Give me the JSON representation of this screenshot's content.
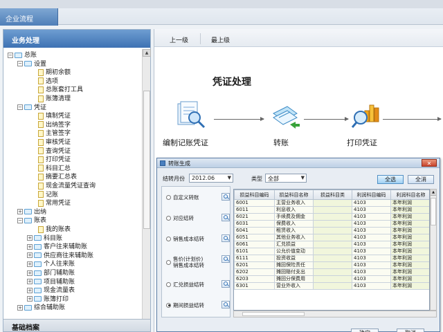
{
  "tabs": {
    "active": "企业流程"
  },
  "left_panel": {
    "header": "业务处理",
    "footer": "基础档案",
    "tree": [
      {
        "label": "总账",
        "type": "folder",
        "toggle": "−"
      },
      {
        "label": "设置",
        "type": "folder",
        "toggle": "−"
      },
      {
        "label": "期初余额",
        "type": "doc"
      },
      {
        "label": "选项",
        "type": "doc"
      },
      {
        "label": "总账套打工具",
        "type": "doc"
      },
      {
        "label": "账簿清理",
        "type": "doc"
      },
      {
        "label": "凭证",
        "type": "folder",
        "toggle": "−"
      },
      {
        "label": "填制凭证",
        "type": "doc"
      },
      {
        "label": "出纳签字",
        "type": "doc"
      },
      {
        "label": "主管签字",
        "type": "doc"
      },
      {
        "label": "审核凭证",
        "type": "doc"
      },
      {
        "label": "查询凭证",
        "type": "doc"
      },
      {
        "label": "打印凭证",
        "type": "doc"
      },
      {
        "label": "科目汇总",
        "type": "doc"
      },
      {
        "label": "摘要汇总表",
        "type": "doc"
      },
      {
        "label": "现金流量凭证查询",
        "type": "doc"
      },
      {
        "label": "记账",
        "type": "doc"
      },
      {
        "label": "常用凭证",
        "type": "doc"
      },
      {
        "label": "出纳",
        "type": "folder",
        "toggle": "+"
      },
      {
        "label": "账表",
        "type": "folder",
        "toggle": "−"
      },
      {
        "label": "我的账表",
        "type": "doc"
      },
      {
        "label": "科目账",
        "type": "folder",
        "toggle": "+"
      },
      {
        "label": "客户往来辅助账",
        "type": "folder",
        "toggle": "+"
      },
      {
        "label": "供应商往来辅助账",
        "type": "folder",
        "toggle": "+"
      },
      {
        "label": "个人往来账",
        "type": "folder",
        "toggle": "+"
      },
      {
        "label": "部门辅助账",
        "type": "folder",
        "toggle": "+"
      },
      {
        "label": "项目辅助账",
        "type": "folder",
        "toggle": "+"
      },
      {
        "label": "现金流量表",
        "type": "folder",
        "toggle": "+"
      },
      {
        "label": "账簿打印",
        "type": "folder",
        "toggle": "+"
      },
      {
        "label": "综合辅助账",
        "type": "folder",
        "toggle": "+"
      }
    ]
  },
  "nav": {
    "prev": "上一级",
    "top": "最上级"
  },
  "flow": {
    "title": "凭证处理",
    "steps": [
      {
        "label": "编制记账凭证",
        "icon": "magnifier-document-icon"
      },
      {
        "label": "转账",
        "icon": "transfer-document-icon"
      },
      {
        "label": "打印凭证",
        "icon": "magnifier-chart-icon"
      }
    ]
  },
  "dialog": {
    "title": "转账生成",
    "close": "✕",
    "month_label": "结转月份",
    "month_value": "2012.06",
    "type_label": "类型",
    "type_value": "全部",
    "select_all": "全选",
    "deselect_all": "全消",
    "options": [
      {
        "label": "自定义转账",
        "checked": false
      },
      {
        "label": "对应结转",
        "checked": false
      },
      {
        "label": "销售成本结转",
        "checked": false
      },
      {
        "label": "售价(计划价)\n销售成本结转",
        "checked": false
      },
      {
        "label": "汇兑损益结转",
        "checked": false
      },
      {
        "label": "期间损益结转",
        "checked": true
      }
    ],
    "columns": [
      "损益科目编码",
      "损益科目名称",
      "损益科目类",
      "利润科目编码",
      "利润科目名称"
    ],
    "rows": [
      [
        "6001",
        "主营业务收入",
        "",
        "4103",
        "本年利润"
      ],
      [
        "6011",
        "利息收入",
        "",
        "4103",
        "本年利润"
      ],
      [
        "6021",
        "手续费及佣金",
        "",
        "4103",
        "本年利润"
      ],
      [
        "6031",
        "保费收入",
        "",
        "4103",
        "本年利润"
      ],
      [
        "6041",
        "租赁收入",
        "",
        "4103",
        "本年利润"
      ],
      [
        "6051",
        "其他业务收入",
        "",
        "4103",
        "本年利润"
      ],
      [
        "6061",
        "汇兑损益",
        "",
        "4103",
        "本年利润"
      ],
      [
        "6101",
        "公允价值变动",
        "",
        "4103",
        "本年利润"
      ],
      [
        "6111",
        "投资收益",
        "",
        "4103",
        "本年利润"
      ],
      [
        "6201",
        "摊回保险责任",
        "",
        "4103",
        "本年利润"
      ],
      [
        "6202",
        "摊回赔付支出",
        "",
        "4103",
        "本年利润"
      ],
      [
        "6203",
        "摊回分保费用",
        "",
        "4103",
        "本年利润"
      ],
      [
        "6301",
        "营业外收入",
        "",
        "4103",
        "本年利润"
      ]
    ],
    "ok": "确定",
    "cancel": "取消"
  }
}
